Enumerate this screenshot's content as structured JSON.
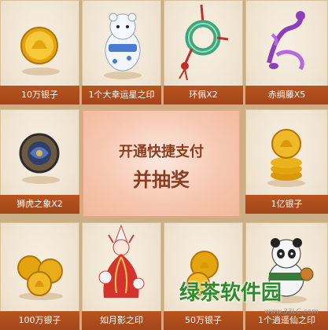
{
  "center": {
    "line1": "开通快捷支付",
    "line2": "并抽奖"
  },
  "prizes": [
    {
      "label": "10万银子",
      "icon": "gold-coin-icon"
    },
    {
      "label": "1个大幸运星之印",
      "icon": "polar-bear-icon"
    },
    {
      "label": "环佩X2",
      "icon": "jade-pendant-icon"
    },
    {
      "label": "赤绸藤X5",
      "icon": "purple-vine-icon"
    },
    {
      "label": "狮虎之象X2",
      "icon": "bronze-amulet-icon"
    },
    {
      "label": "1亿银子",
      "icon": "coin-stack-icon"
    },
    {
      "label": "100万银子",
      "icon": "gold-coins-icon"
    },
    {
      "label": "如月影之印",
      "icon": "fox-girl-icon"
    },
    {
      "label": "50万银子",
      "icon": "gold-coins-icon"
    },
    {
      "label": "1个逍遥仙之印",
      "icon": "panda-icon"
    }
  ],
  "watermark": {
    "text": "绿茶软件园",
    "url": "www.33LC.com"
  },
  "colors": {
    "label_bg": "#b04e1c",
    "center_text": "#8c3d1f",
    "watermark_green": "#2f8a2c"
  }
}
